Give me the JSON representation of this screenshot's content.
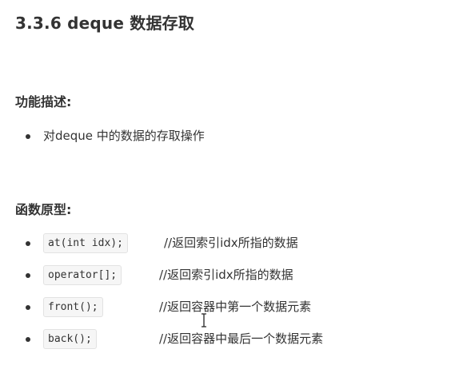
{
  "title": "3.3.6 deque 数据存取",
  "description_section": {
    "heading": "功能描述:",
    "items": [
      "对deque 中的数据的存取操作"
    ]
  },
  "prototype_section": {
    "heading": "函数原型:",
    "items": [
      {
        "code": "at(int idx);",
        "comment": "//返回索引idx所指的数据"
      },
      {
        "code": "operator[];",
        "comment": "//返回索引idx所指的数据"
      },
      {
        "code": "front();",
        "comment": "//返回容器中第一个数据元素"
      },
      {
        "code": "back();",
        "comment": "//返回容器中最后一个数据元素"
      }
    ]
  },
  "colors": {
    "text": "#333333",
    "code_background": "#f6f6f6",
    "code_border": "#e2e2e2"
  },
  "icons": {
    "cursor": "text-cursor-icon"
  }
}
